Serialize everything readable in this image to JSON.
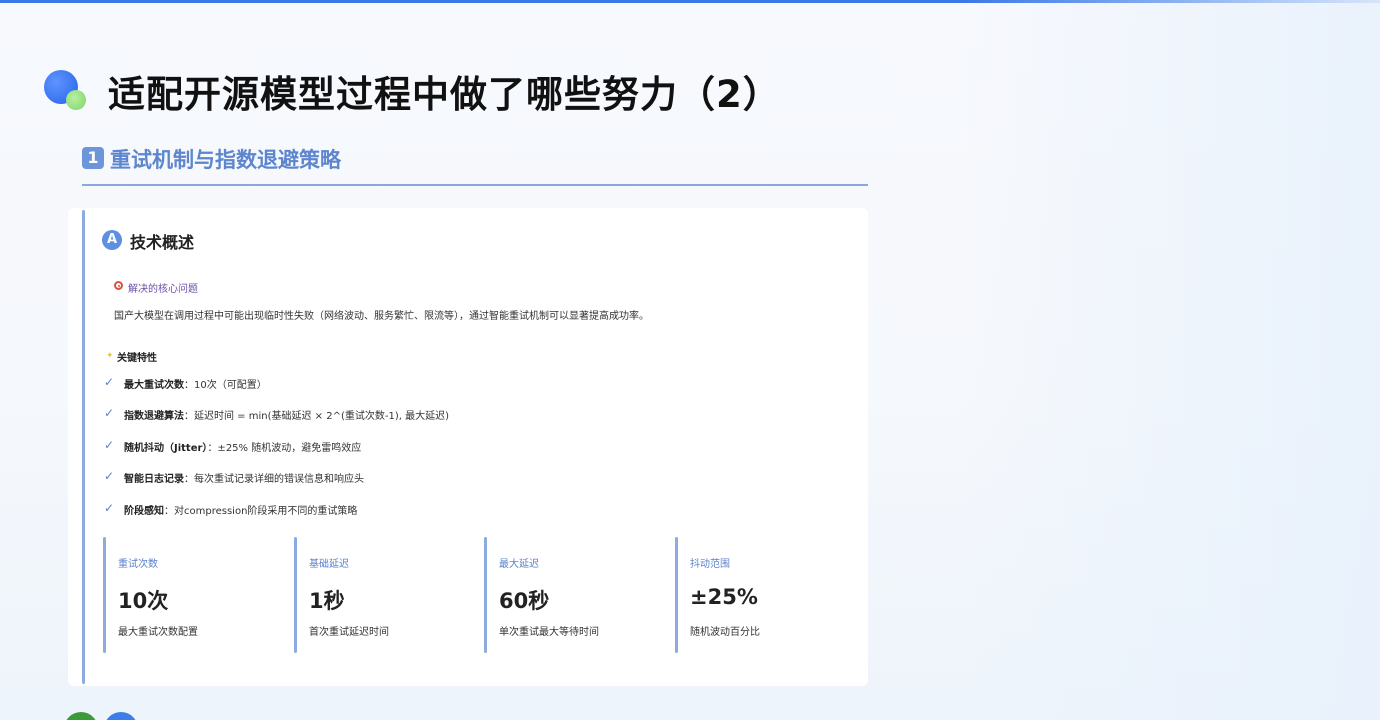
{
  "page": {
    "title": "适配开源模型过程中做了哪些努力（2）"
  },
  "section": {
    "number": "1",
    "title": "重试机制与指数退避策略"
  },
  "overview": {
    "badge": "A",
    "title": "技术概述",
    "problem_label": "解决的核心问题",
    "problem_desc": "国产大模型在调用过程中可能出现临时性失败（网络波动、服务繁忙、限流等），通过智能重试机制可以显著提高成功率。",
    "features_label": "关键特性",
    "features": [
      {
        "name": "最大重试次数",
        "desc": "：10次（可配置）"
      },
      {
        "name": "指数退避算法",
        "desc": "：延迟时间 = min(基础延迟 × 2^(重试次数-1), 最大延迟)"
      },
      {
        "name": "随机抖动（Jitter）",
        "desc": "：±25% 随机波动，避免雷鸣效应"
      },
      {
        "name": "智能日志记录",
        "desc": "：每次重试记录详细的错误信息和响应头"
      },
      {
        "name": "阶段感知",
        "desc": "：对compression阶段采用不同的重试策略"
      }
    ]
  },
  "stats": [
    {
      "label": "重试次数",
      "value": "10次",
      "desc": "最大重试次数配置"
    },
    {
      "label": "基础延迟",
      "value": "1秒",
      "desc": "首次重试延迟时间"
    },
    {
      "label": "最大延迟",
      "value": "60秒",
      "desc": "单次重试最大等待时间"
    },
    {
      "label": "抖动范围",
      "value": "±25%",
      "desc": "随机波动百分比"
    }
  ],
  "colors": {
    "accent_blue": "#3a78e8",
    "section_title": "#5d86cf",
    "card_accent": "#8eabdf",
    "problem_label": "#6b4ea8"
  },
  "icons": {
    "logo": "blue-green-dots-logo",
    "section_badge": "keycap-one-icon",
    "overview_badge": "circled-a-icon",
    "problem": "target-icon",
    "features": "sparkle-icon",
    "feature_item": "checkmark-icon"
  }
}
